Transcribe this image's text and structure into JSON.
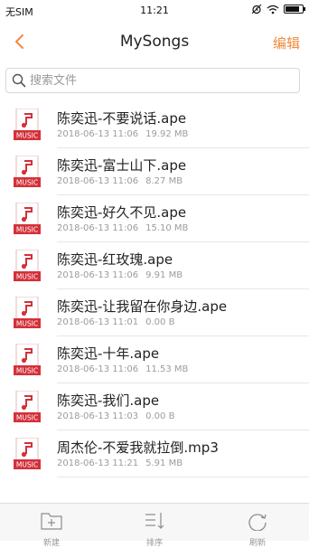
{
  "status_bar": {
    "carrier": "无SIM",
    "time": "11:21",
    "battery_level": 0.85
  },
  "nav": {
    "title": "MySongs",
    "edit_label": "编辑"
  },
  "search": {
    "placeholder": "搜索文件",
    "value": ""
  },
  "colors": {
    "accent": "#f08a3c",
    "music_icon_red": "#d4303a"
  },
  "icons": {
    "back": "chevron-left-icon",
    "search": "search-icon",
    "file": "music-file-icon",
    "tab_new": "add-folder-icon",
    "tab_sort": "sort-icon",
    "tab_refresh": "refresh-icon"
  },
  "music_icon_text": "MUSIC",
  "files": [
    {
      "name": "陈奕迅-不要说话.ape",
      "date": "2018-06-13 11:06",
      "size": "19.92 MB"
    },
    {
      "name": "陈奕迅-富士山下.ape",
      "date": "2018-06-13 11:06",
      "size": "8.27 MB"
    },
    {
      "name": "陈奕迅-好久不见.ape",
      "date": "2018-06-13 11:06",
      "size": "15.10 MB"
    },
    {
      "name": "陈奕迅-红玫瑰.ape",
      "date": "2018-06-13 11:06",
      "size": "9.91 MB"
    },
    {
      "name": "陈奕迅-让我留在你身边.ape",
      "date": "2018-06-13 11:01",
      "size": "0.00 B"
    },
    {
      "name": "陈奕迅-十年.ape",
      "date": "2018-06-13 11:06",
      "size": "11.53 MB"
    },
    {
      "name": "陈奕迅-我们.ape",
      "date": "2018-06-13 11:03",
      "size": "0.00 B"
    },
    {
      "name": "周杰伦-不爱我就拉倒.mp3",
      "date": "2018-06-13 11:21",
      "size": "5.91 MB"
    }
  ],
  "tabs": [
    {
      "label": "新建"
    },
    {
      "label": "排序"
    },
    {
      "label": "刷新"
    }
  ]
}
